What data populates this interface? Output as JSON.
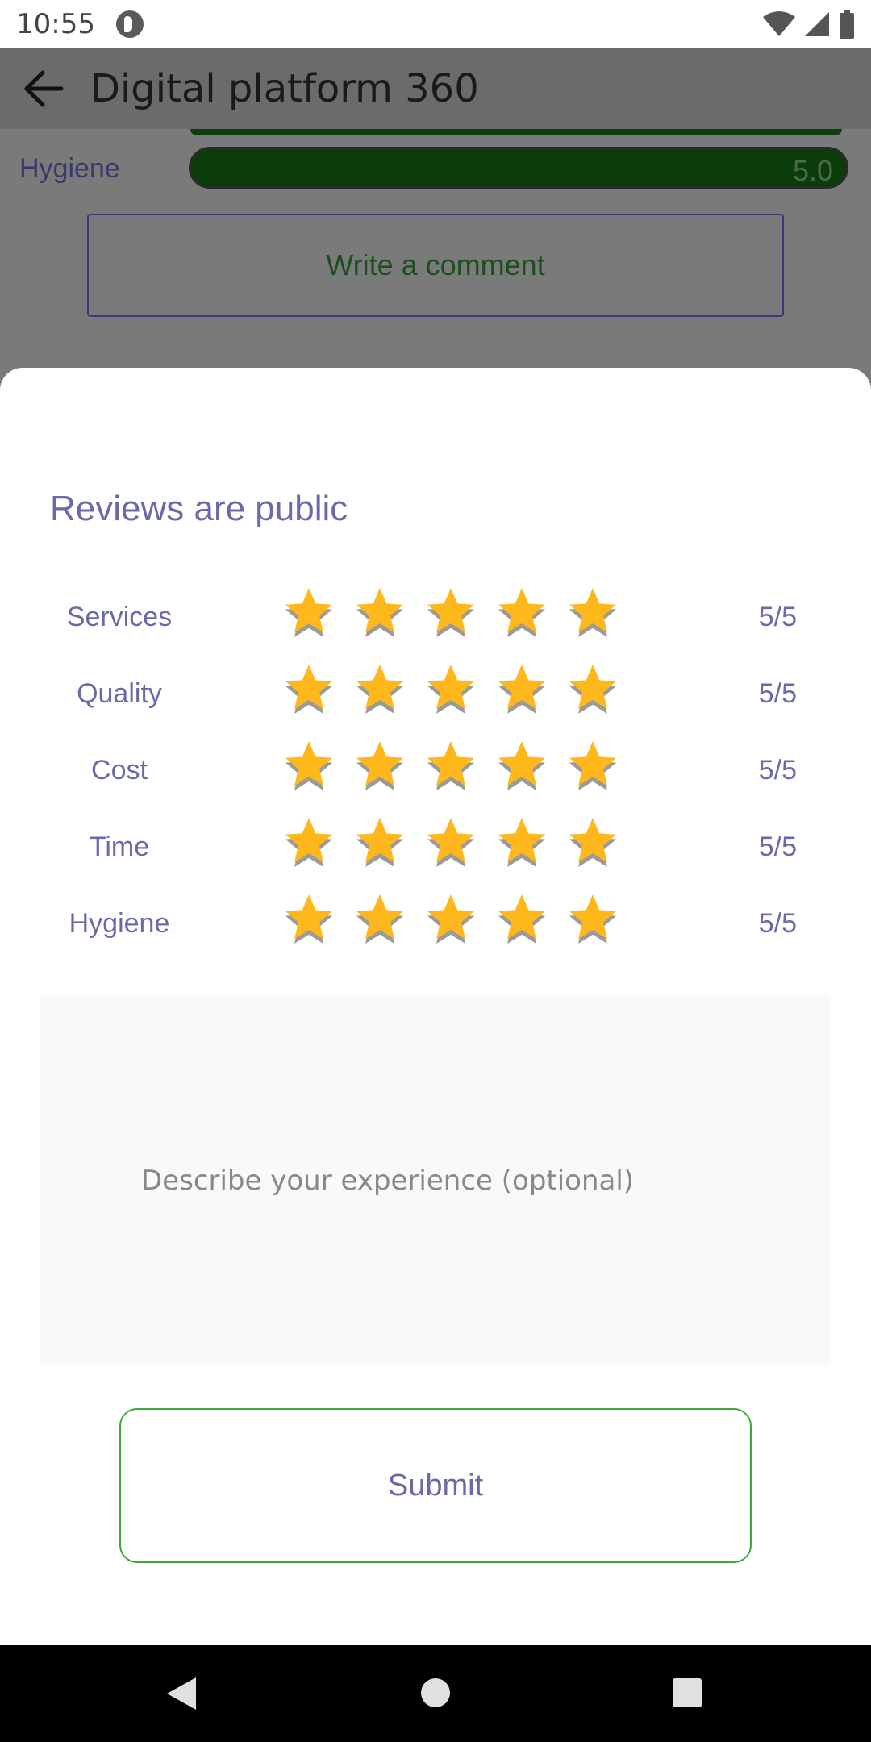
{
  "status": {
    "time": "10:55"
  },
  "appbar": {
    "title": "Digital platform 360"
  },
  "background": {
    "row_label": "Hygiene",
    "row_value": "5.0",
    "comment_button": "Write a comment"
  },
  "sheet": {
    "title": "Reviews are public",
    "ratings": [
      {
        "label": "Services",
        "score": "5/5",
        "stars": 5
      },
      {
        "label": "Quality",
        "score": "5/5",
        "stars": 5
      },
      {
        "label": "Cost",
        "score": "5/5",
        "stars": 5
      },
      {
        "label": "Time",
        "score": "5/5",
        "stars": 5
      },
      {
        "label": "Hygiene",
        "score": "5/5",
        "stars": 5
      }
    ],
    "experience_placeholder": "Describe your experience (optional)",
    "submit_label": "Submit"
  },
  "colors": {
    "star_fill": "#ffb81c",
    "accent_text": "#6a6aaa",
    "submit_border": "#3aa83a"
  }
}
